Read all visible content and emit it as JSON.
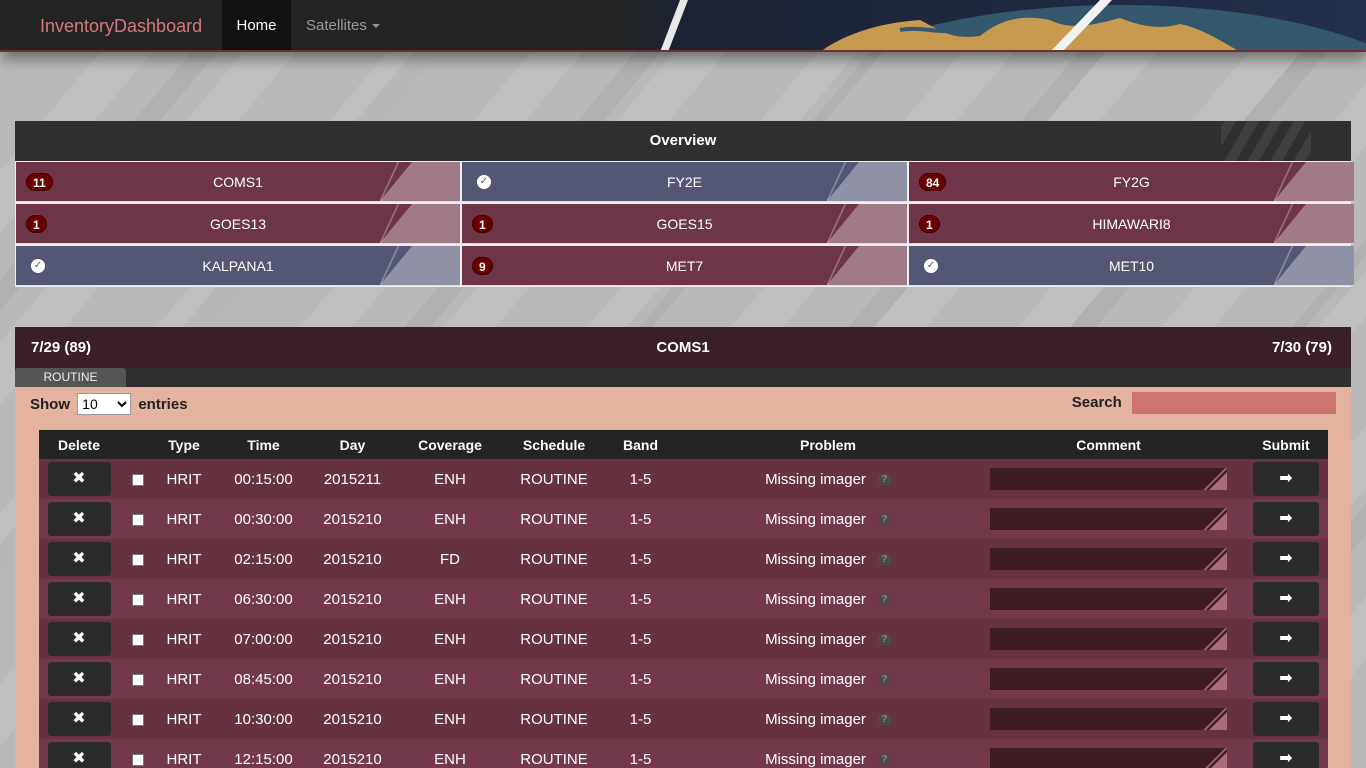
{
  "navbar": {
    "brand": "InventoryDashboard",
    "home": "Home",
    "satellites": "Satellites"
  },
  "overview": {
    "title": "Overview",
    "satellites": [
      {
        "name": "COMS1",
        "status": "problem",
        "count": "11"
      },
      {
        "name": "FY2E",
        "status": "ok",
        "count": ""
      },
      {
        "name": "FY2G",
        "status": "problem",
        "count": "84"
      },
      {
        "name": "GOES13",
        "status": "problem",
        "count": "1"
      },
      {
        "name": "GOES15",
        "status": "problem",
        "count": "1"
      },
      {
        "name": "HIMAWARI8",
        "status": "problem",
        "count": "1"
      },
      {
        "name": "KALPANA1",
        "status": "ok",
        "count": ""
      },
      {
        "name": "MET7",
        "status": "problem",
        "count": "9"
      },
      {
        "name": "MET10",
        "status": "ok",
        "count": ""
      }
    ],
    "colors": {
      "problem": "#6e3447",
      "ok": "#545774",
      "badge": "#6a0000"
    }
  },
  "detail": {
    "left": "7/29 (89)",
    "title": "COMS1",
    "right": "7/30 (79)",
    "tab": "ROUTINE",
    "show_label": "Show",
    "show_value": "10",
    "entries_label": "entries",
    "search_label": "Search",
    "columns": [
      "Delete",
      "",
      "Type",
      "Time",
      "Day",
      "Coverage",
      "Schedule",
      "Band",
      "Problem",
      "Comment",
      "Submit"
    ],
    "delete_icon": "✖",
    "submit_icon": "➡",
    "help_icon": "?",
    "rows": [
      {
        "type": "HRIT",
        "time": "00:15:00",
        "day": "2015211",
        "coverage": "ENH",
        "schedule": "ROUTINE",
        "band": "1-5",
        "problem": "Missing imager"
      },
      {
        "type": "HRIT",
        "time": "00:30:00",
        "day": "2015210",
        "coverage": "ENH",
        "schedule": "ROUTINE",
        "band": "1-5",
        "problem": "Missing imager"
      },
      {
        "type": "HRIT",
        "time": "02:15:00",
        "day": "2015210",
        "coverage": "FD",
        "schedule": "ROUTINE",
        "band": "1-5",
        "problem": "Missing imager"
      },
      {
        "type": "HRIT",
        "time": "06:30:00",
        "day": "2015210",
        "coverage": "ENH",
        "schedule": "ROUTINE",
        "band": "1-5",
        "problem": "Missing imager"
      },
      {
        "type": "HRIT",
        "time": "07:00:00",
        "day": "2015210",
        "coverage": "ENH",
        "schedule": "ROUTINE",
        "band": "1-5",
        "problem": "Missing imager"
      },
      {
        "type": "HRIT",
        "time": "08:45:00",
        "day": "2015210",
        "coverage": "ENH",
        "schedule": "ROUTINE",
        "band": "1-5",
        "problem": "Missing imager"
      },
      {
        "type": "HRIT",
        "time": "10:30:00",
        "day": "2015210",
        "coverage": "ENH",
        "schedule": "ROUTINE",
        "band": "1-5",
        "problem": "Missing imager"
      },
      {
        "type": "HRIT",
        "time": "12:15:00",
        "day": "2015210",
        "coverage": "ENH",
        "schedule": "ROUTINE",
        "band": "1-5",
        "problem": "Missing imager"
      }
    ]
  }
}
